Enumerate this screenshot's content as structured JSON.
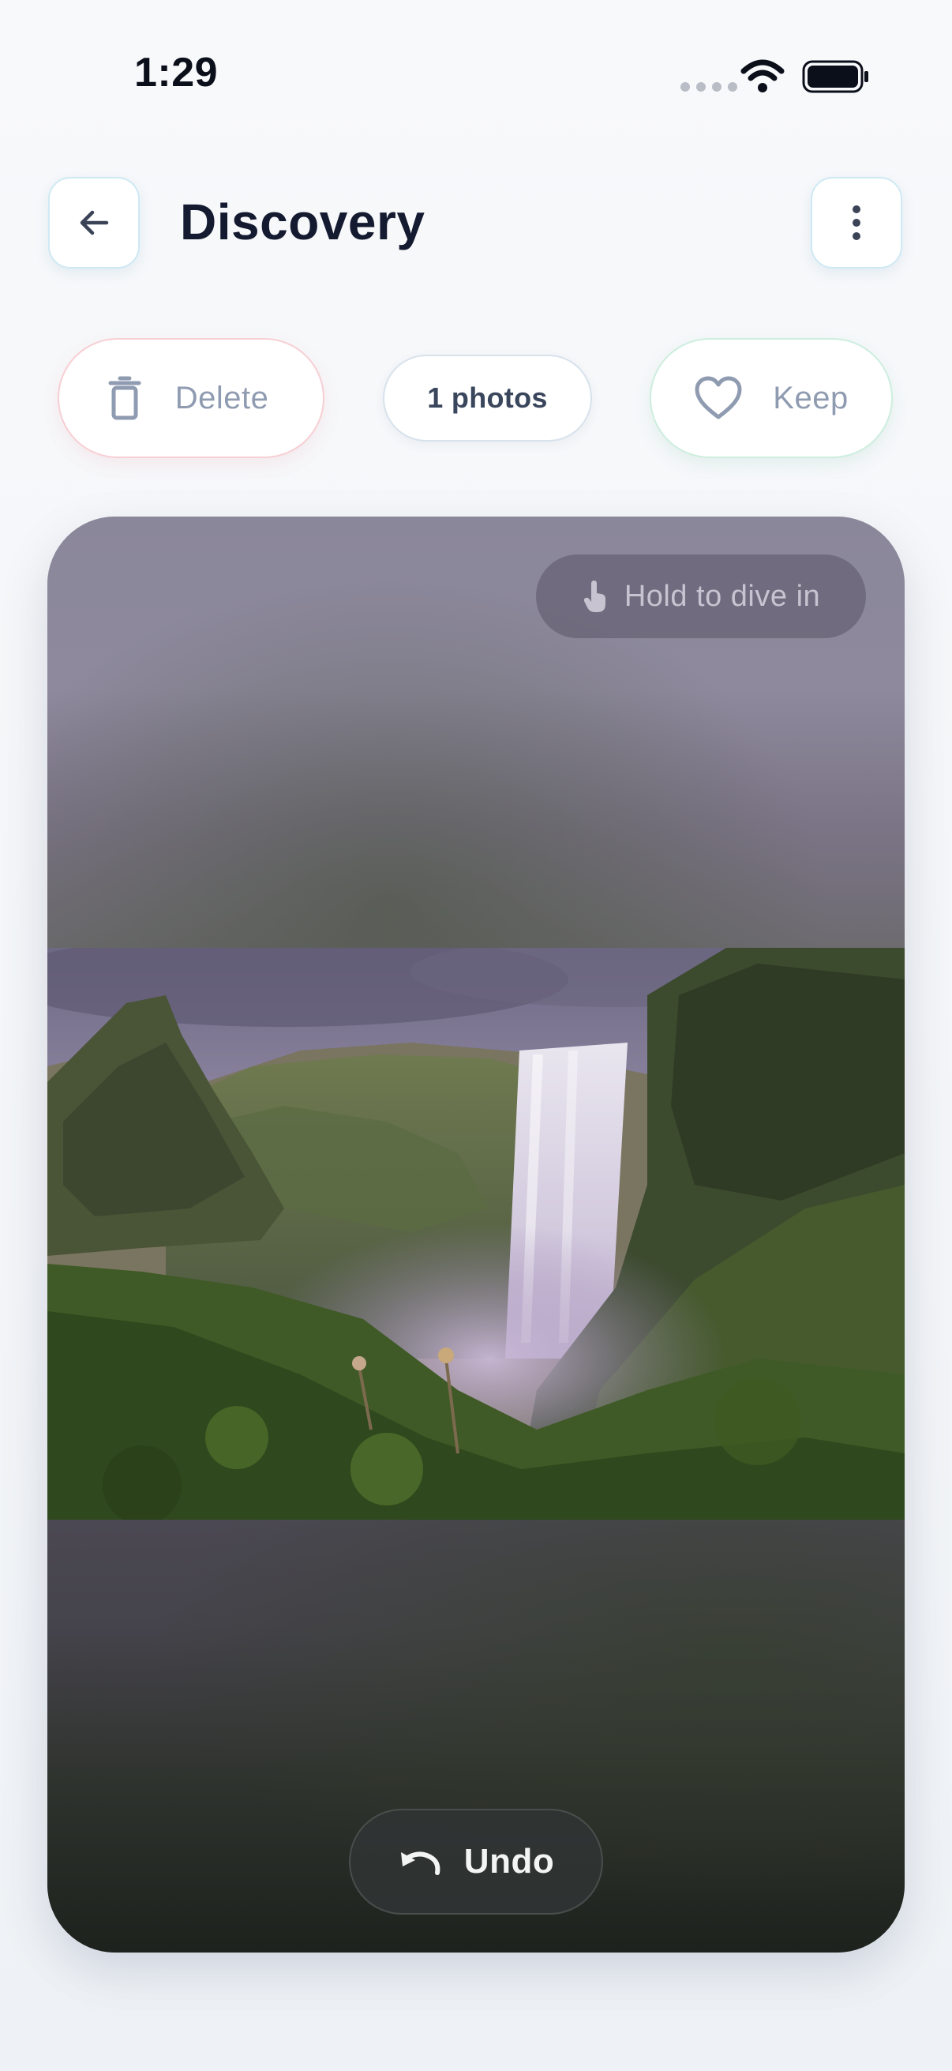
{
  "status_bar": {
    "time": "1:29",
    "icons": [
      "signal-dots-icon",
      "wifi-icon",
      "battery-icon"
    ]
  },
  "header": {
    "title": "Discovery",
    "back_icon": "arrow-left-icon",
    "menu_icon": "more-vertical-icon"
  },
  "actions": {
    "delete_label": "Delete",
    "delete_icon": "trash-icon",
    "count_label": "1 photos",
    "keep_label": "Keep",
    "keep_icon": "heart-icon"
  },
  "photo": {
    "hint_label": "Hold to dive in",
    "hint_icon": "tap-hand-icon",
    "subject": "waterfall landscape",
    "undo_label": "Undo",
    "undo_icon": "undo-arrow-icon"
  },
  "colors": {
    "title": "#141a30",
    "delete_border": "#f7cfd4",
    "keep_border": "#cdeede",
    "icon_button_border": "#cfe9f4",
    "muted_label": "#8f9bb0"
  }
}
